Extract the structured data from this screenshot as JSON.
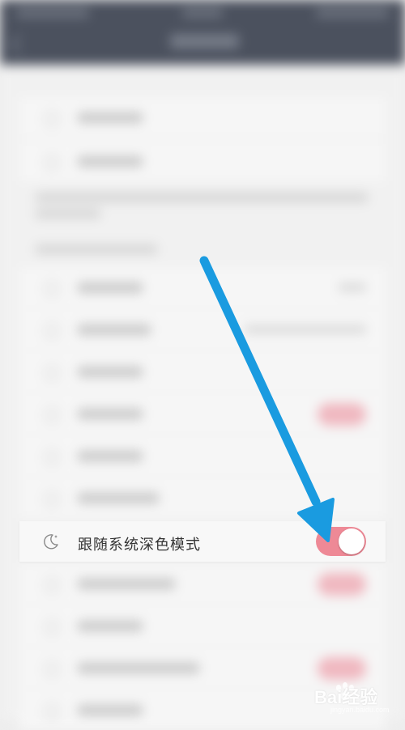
{
  "setting": {
    "label": "跟随系统深色模式",
    "icon": "moon-icon",
    "toggle_on": true
  },
  "colors": {
    "toggle_on": "#ee8996",
    "arrow": "#1a9be0",
    "statusbar": "#4b515e"
  },
  "watermark": {
    "text": "Bai经验",
    "sub": "jingyan.baidu.com"
  }
}
